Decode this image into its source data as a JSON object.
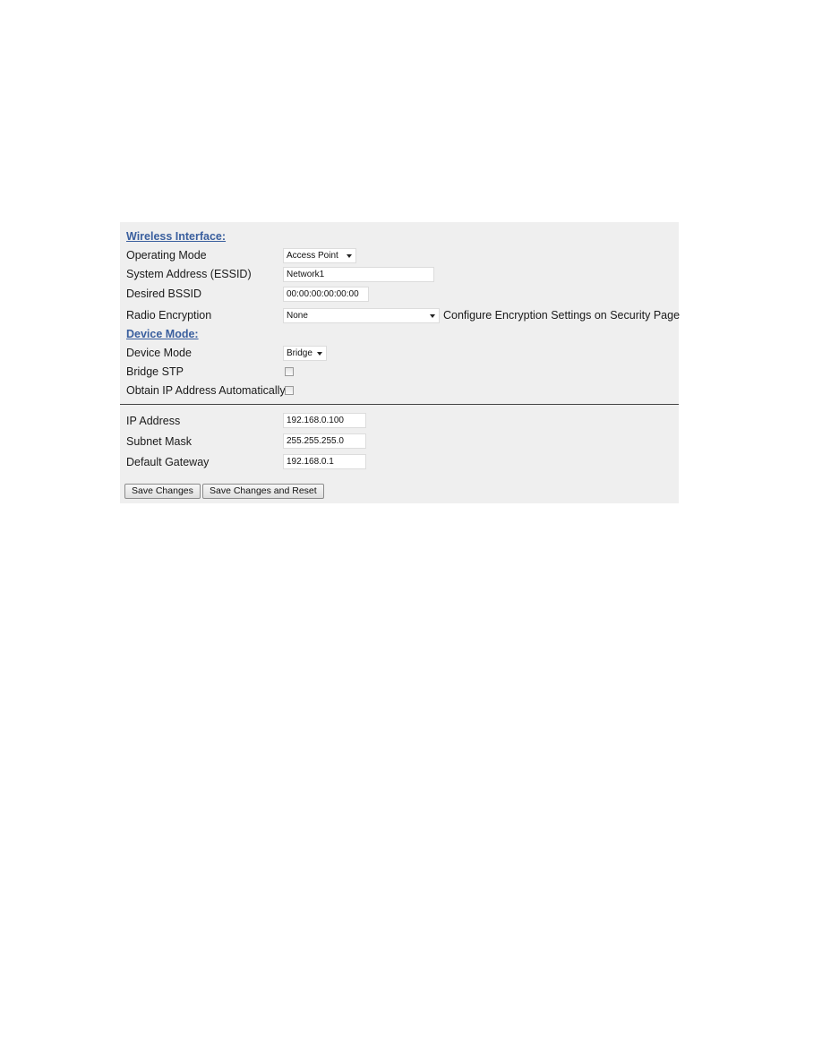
{
  "wireless_interface": {
    "title": "Wireless Interface:",
    "operating_mode": {
      "label": "Operating Mode",
      "value": "Access Point",
      "icon": "chevron-down-icon"
    },
    "essid": {
      "label": "System Address (ESSID)",
      "value": "Network1"
    },
    "bssid": {
      "label": "Desired BSSID",
      "value": "00:00:00:00:00:00"
    },
    "radio_encryption": {
      "label": "Radio Encryption",
      "value": "None",
      "icon": "chevron-down-icon",
      "note": "Configure Encryption Settings on Security Page"
    }
  },
  "device_mode": {
    "title": "Device Mode:",
    "device_mode": {
      "label": "Device Mode",
      "value": "Bridge",
      "icon": "chevron-down-icon"
    },
    "bridge_stp": {
      "label": "Bridge STP",
      "checked": false
    },
    "obtain_ip": {
      "label": "Obtain IP Address Automatically",
      "checked": false
    }
  },
  "ip_settings": {
    "ip_address": {
      "label": "IP Address",
      "value": "192.168.0.100"
    },
    "subnet_mask": {
      "label": "Subnet Mask",
      "value": "255.255.255.0"
    },
    "default_gateway": {
      "label": "Default Gateway",
      "value": "192.168.0.1"
    }
  },
  "buttons": {
    "save": "Save Changes",
    "save_reset": "Save Changes and Reset"
  },
  "colors": {
    "section_title": "#3a5f9e",
    "panel_background": "#efefef"
  }
}
